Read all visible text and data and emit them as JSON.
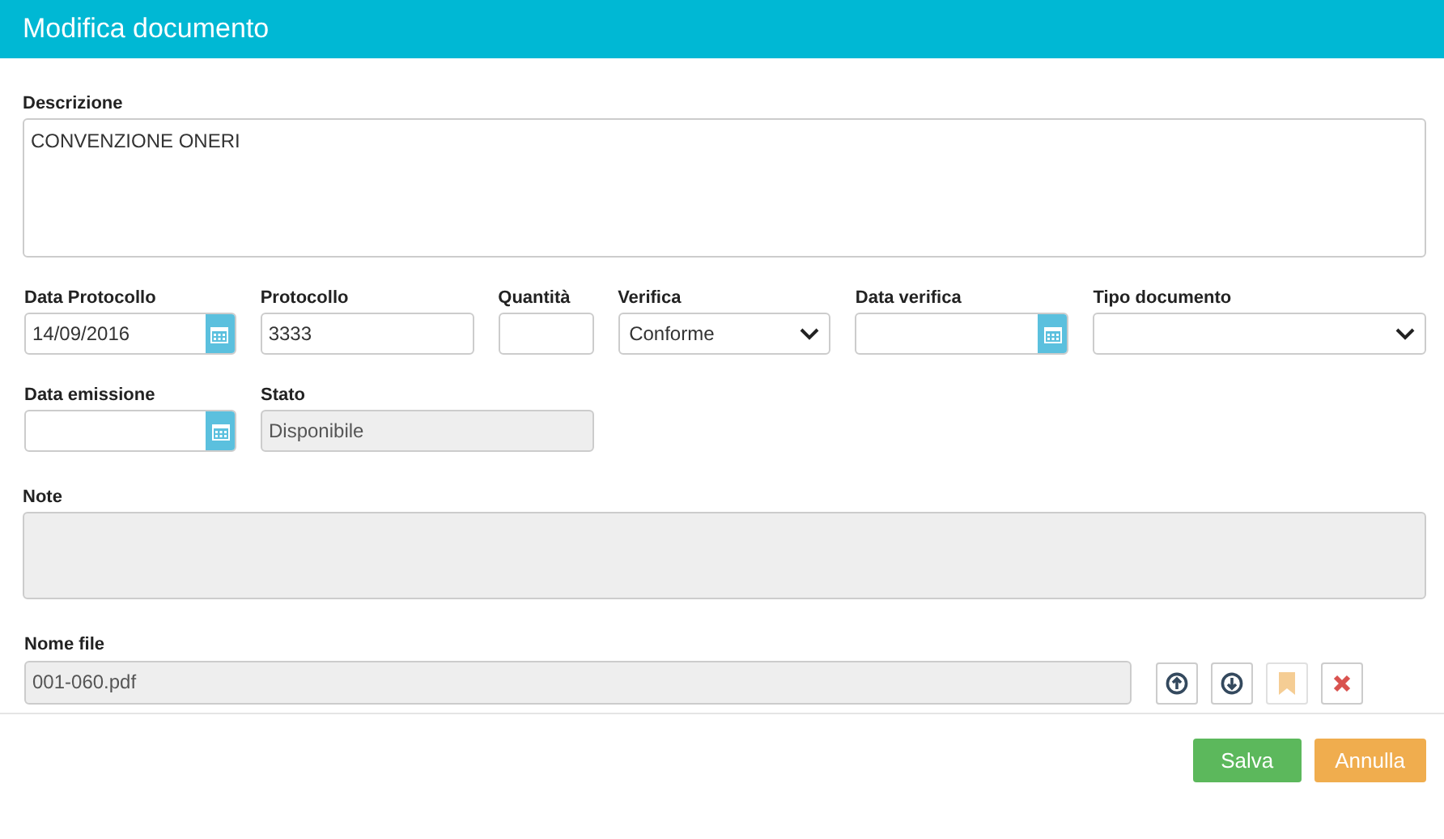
{
  "dialog": {
    "title": "Modifica documento"
  },
  "description": {
    "label": "Descrizione",
    "value": "CONVENZIONE ONERI"
  },
  "rows": [
    [
      {
        "label": "Data Protocollo",
        "kind": "date",
        "value": "14/09/2016",
        "disabled": false
      },
      {
        "label": "Protocollo",
        "kind": "text",
        "value": "3333",
        "disabled": false
      },
      {
        "label": "Quantità",
        "kind": "text",
        "disabled": false
      },
      {
        "label": "Verifica",
        "kind": "select",
        "value": "Conforme",
        "disabled": false
      },
      {
        "label": "Data verifica",
        "kind": "date",
        "disabled": false
      },
      {
        "label": "Tipo documento",
        "kind": "select",
        "disabled": false
      }
    ],
    [
      {
        "label": "Data emissione",
        "kind": "date",
        "disabled": false
      },
      {
        "label": "Stato",
        "kind": "text",
        "value": "Disponibile",
        "disabled": true
      }
    ]
  ],
  "note": {
    "label": "Note",
    "disabled": true
  },
  "file": {
    "label": "Nome file",
    "value": "001-060.pdf",
    "disabled": true,
    "actions": [
      {
        "kind": "upload",
        "disabled": false
      },
      {
        "kind": "download",
        "disabled": false
      },
      {
        "kind": "bookmark",
        "disabled": true
      },
      {
        "kind": "delete",
        "disabled": false
      }
    ]
  },
  "buttons": [
    {
      "label": "Salva",
      "kind": "primary"
    },
    {
      "label": "Annulla",
      "kind": "cancel"
    }
  ]
}
